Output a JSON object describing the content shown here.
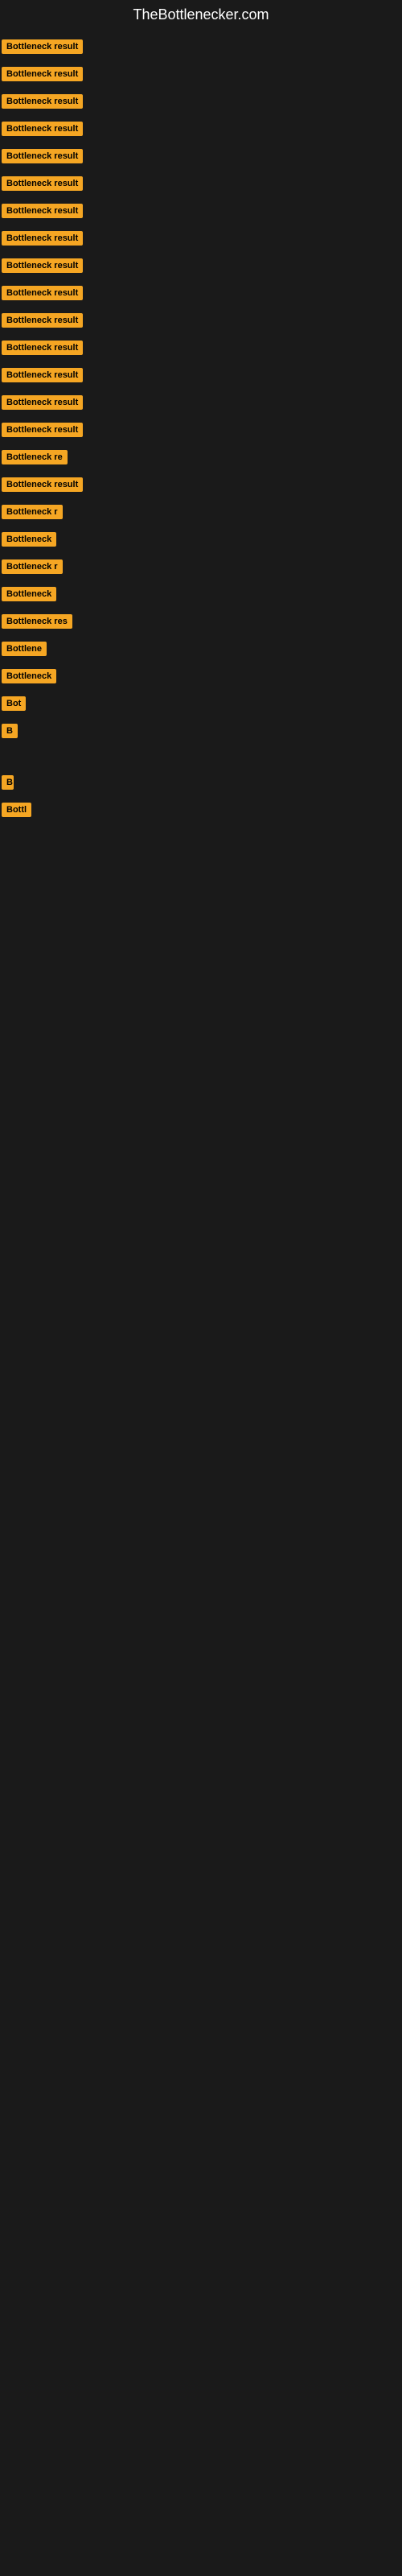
{
  "site": {
    "title": "TheBottlenecker.com"
  },
  "items": [
    {
      "label": "Bottleneck result",
      "width": 130
    },
    {
      "label": "Bottleneck result",
      "width": 130
    },
    {
      "label": "Bottleneck result",
      "width": 130
    },
    {
      "label": "Bottleneck result",
      "width": 130
    },
    {
      "label": "Bottleneck result",
      "width": 130
    },
    {
      "label": "Bottleneck result",
      "width": 130
    },
    {
      "label": "Bottleneck result",
      "width": 130
    },
    {
      "label": "Bottleneck result",
      "width": 130
    },
    {
      "label": "Bottleneck result",
      "width": 130
    },
    {
      "label": "Bottleneck result",
      "width": 130
    },
    {
      "label": "Bottleneck result",
      "width": 130
    },
    {
      "label": "Bottleneck result",
      "width": 130
    },
    {
      "label": "Bottleneck result",
      "width": 130
    },
    {
      "label": "Bottleneck result",
      "width": 130
    },
    {
      "label": "Bottleneck result",
      "width": 130
    },
    {
      "label": "Bottleneck re",
      "width": 105
    },
    {
      "label": "Bottleneck result",
      "width": 120
    },
    {
      "label": "Bottleneck r",
      "width": 98
    },
    {
      "label": "Bottleneck",
      "width": 88
    },
    {
      "label": "Bottleneck r",
      "width": 95
    },
    {
      "label": "Bottleneck",
      "width": 85
    },
    {
      "label": "Bottleneck res",
      "width": 108
    },
    {
      "label": "Bottlene",
      "width": 75
    },
    {
      "label": "Bottleneck",
      "width": 82
    },
    {
      "label": "Bot",
      "width": 38
    },
    {
      "label": "B",
      "width": 22
    },
    {
      "label": "",
      "width": 0
    },
    {
      "label": "B",
      "width": 15
    },
    {
      "label": "Bottl",
      "width": 42
    },
    {
      "label": "",
      "width": 0
    },
    {
      "label": "",
      "width": 0
    },
    {
      "label": "",
      "width": 0
    },
    {
      "label": "",
      "width": 0
    },
    {
      "label": "",
      "width": 0
    },
    {
      "label": "",
      "width": 0
    }
  ]
}
